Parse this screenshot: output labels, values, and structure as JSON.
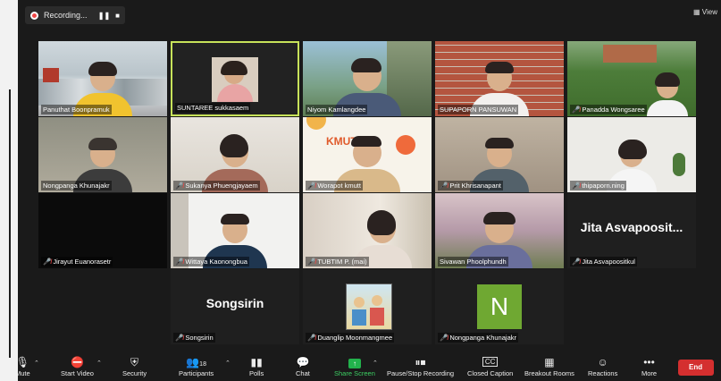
{
  "recording": {
    "label": "Recording...",
    "pause": "❚❚",
    "stop": "■"
  },
  "view_button": "View",
  "tiles": [
    {
      "name": "Panuthat Boonpramuk",
      "muted": false
    },
    {
      "name": "SUNTAREE sukkasaem",
      "muted": false
    },
    {
      "name": "Niyom Kamlangdee",
      "muted": false
    },
    {
      "name": "SUPAPORN PANSUWAN",
      "muted": false
    },
    {
      "name": "Panadda Wongsaree",
      "muted": true
    },
    {
      "name": "Nongpanga Khunajakr",
      "muted": false
    },
    {
      "name": "Sukanya Phuengjayaem",
      "muted": true
    },
    {
      "name": "Worapot kmutt",
      "muted": true
    },
    {
      "name": "Prit Khrisanapant",
      "muted": true
    },
    {
      "name": "thipaporn.ning",
      "muted": true
    },
    {
      "name": "Jirayut Euanorasetr",
      "muted": true
    },
    {
      "name": "Wittaya Kaonongbua",
      "muted": true
    },
    {
      "name": "TUBTIM P. (mai)",
      "muted": true
    },
    {
      "name": "Sivawan Phoolphundh",
      "muted": false
    },
    {
      "name": "Jita Asvapoositkul",
      "muted": true,
      "big": "Jita Asvapoosit..."
    },
    {
      "name": "Songsirin",
      "muted": true,
      "big": "Songsirin"
    },
    {
      "name": "Duanglip Moonmangmee",
      "muted": true
    },
    {
      "name": "Nongpanga Khunajakr",
      "muted": true,
      "letter": "N"
    }
  ],
  "toolbar": {
    "mute": "Mute",
    "start_video": "Start Video",
    "security": "Security",
    "participants": "Participants",
    "participants_count": "18",
    "polls": "Polls",
    "chat": "Chat",
    "share_screen": "Share Screen",
    "pause_stop": "Pause/Stop Recording",
    "closed_caption": "Closed Caption",
    "breakout": "Breakout Rooms",
    "reactions": "Reactions",
    "more": "More",
    "end": "End"
  },
  "colors": {
    "active_border": "#c7e25a",
    "share_green": "#22b24c",
    "end_red": "#d42f2f",
    "avatar_green": "#6fa832"
  }
}
